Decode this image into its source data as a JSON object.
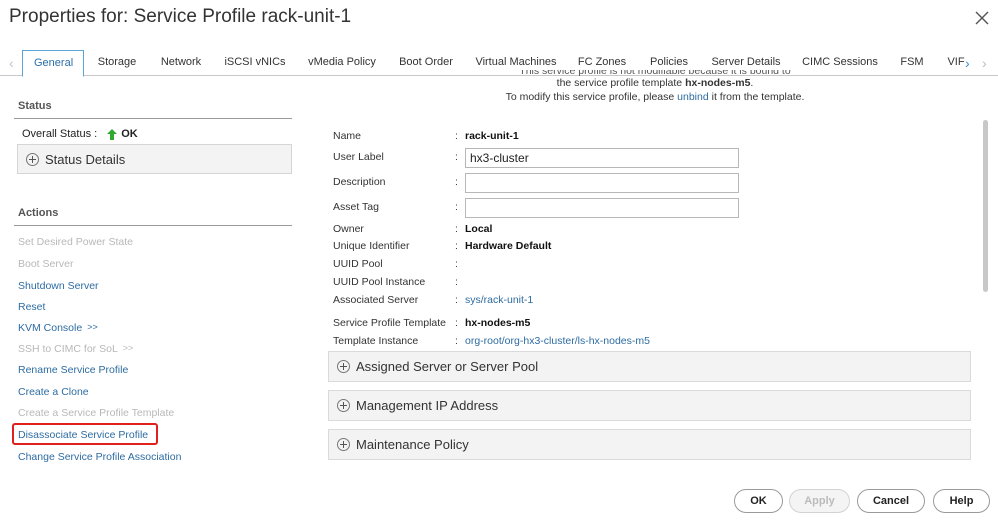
{
  "window": {
    "title": "Properties for: Service Profile rack-unit-1"
  },
  "tabs": [
    {
      "label": "General",
      "active": true
    },
    {
      "label": "Storage"
    },
    {
      "label": "Network"
    },
    {
      "label": "iSCSI vNICs"
    },
    {
      "label": "vMedia Policy"
    },
    {
      "label": "Boot Order"
    },
    {
      "label": "Virtual Machines"
    },
    {
      "label": "FC Zones"
    },
    {
      "label": "Policies"
    },
    {
      "label": "Server Details"
    },
    {
      "label": "CIMC Sessions"
    },
    {
      "label": "FSM"
    },
    {
      "label": "VIF"
    }
  ],
  "status": {
    "heading": "Status",
    "overall_label": "Overall Status :",
    "overall_value": "OK",
    "details_label": "Status Details"
  },
  "actions": {
    "heading": "Actions",
    "items": [
      {
        "label": "Set Desired Power State",
        "enabled": false
      },
      {
        "label": "Boot Server",
        "enabled": false
      },
      {
        "label": "Shutdown Server",
        "enabled": true
      },
      {
        "label": "Reset",
        "enabled": true
      },
      {
        "label": "KVM Console",
        "enabled": true,
        "suffix": ">>"
      },
      {
        "label": "SSH to CIMC for SoL",
        "enabled": false,
        "suffix": ">>"
      },
      {
        "label": "Rename Service Profile",
        "enabled": true
      },
      {
        "label": "Create a Clone",
        "enabled": true
      },
      {
        "label": "Create a Service Profile Template",
        "enabled": false
      },
      {
        "label": "Disassociate Service Profile",
        "enabled": true,
        "highlighted": true
      },
      {
        "label": "Change Service Profile Association",
        "enabled": true
      }
    ]
  },
  "notice": {
    "line1": "This service profile is not modifiable because it is bound to",
    "line2_prefix": "the service profile template ",
    "line2_template": "hx-nodes-m5",
    "line2_suffix": ".",
    "line3_prefix": "To modify this service profile, please ",
    "line3_link": "unbind",
    "line3_suffix": " it from the template."
  },
  "properties": {
    "name_label": "Name",
    "name_value": "rack-unit-1",
    "user_label_label": "User Label",
    "user_label_value": "hx3-cluster",
    "description_label": "Description",
    "description_value": "",
    "asset_tag_label": "Asset Tag",
    "asset_tag_value": "",
    "owner_label": "Owner",
    "owner_value": "Local",
    "uid_label": "Unique Identifier",
    "uid_value": "Hardware Default",
    "uuid_pool_label": "UUID Pool",
    "uuid_pool_value": "",
    "uuid_pool_instance_label": "UUID Pool Instance",
    "uuid_pool_instance_value": "",
    "assoc_server_label": "Associated Server",
    "assoc_server_value": "sys/rack-unit-1",
    "sp_template_label": "Service Profile Template",
    "sp_template_value": "hx-nodes-m5",
    "template_instance_label": "Template Instance",
    "template_instance_value": "org-root/org-hx3-cluster/ls-hx-nodes-m5",
    "colon": ":"
  },
  "expanders": [
    {
      "label": "Assigned Server or Server Pool"
    },
    {
      "label": "Management IP Address"
    },
    {
      "label": "Maintenance Policy"
    }
  ],
  "buttons": {
    "ok": "OK",
    "apply": "Apply",
    "cancel": "Cancel",
    "help": "Help"
  },
  "icons": {
    "close": "close-icon",
    "tab_prev": "chevron-left-icon",
    "tab_next": "chevron-right-icon",
    "status_ok": "arrow-up-icon",
    "expand": "plus-circle-icon"
  },
  "colors": {
    "link": "#2d6ca2",
    "ok_arrow": "#2eaa2e",
    "highlight": "#e0201a",
    "active_tab_border": "#5ba4d6"
  }
}
